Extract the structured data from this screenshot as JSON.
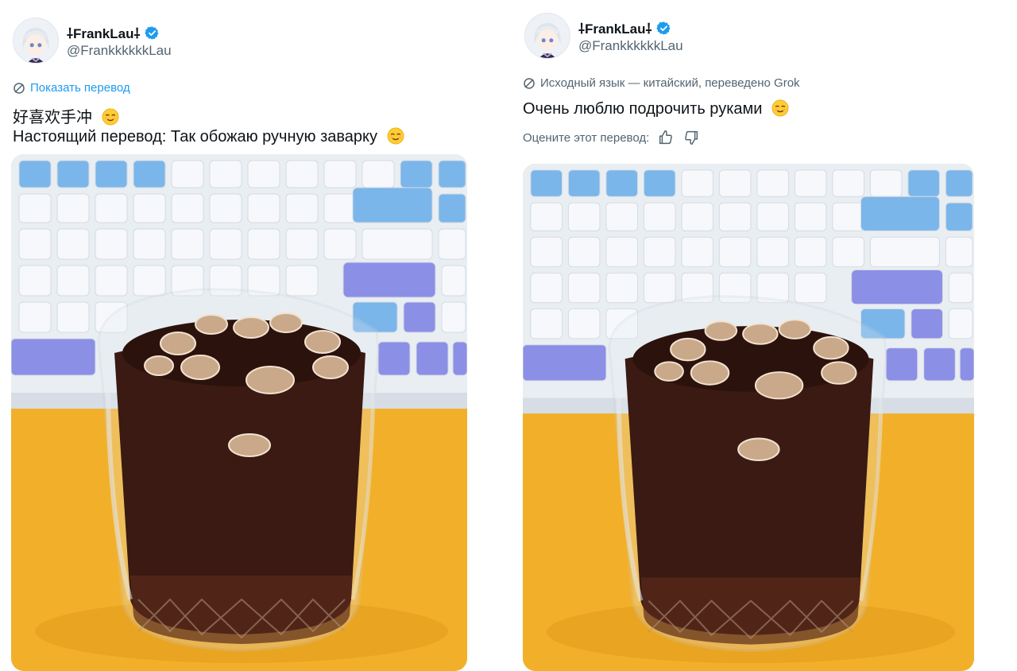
{
  "posts": [
    {
      "author": {
        "display_name": "⸸FrankLau⸸",
        "handle": "@FrankkkkkkLau",
        "verified": true
      },
      "translate_link": "Показать перевод",
      "text_lines": [
        "好喜欢手冲",
        "Настоящий перевод: Так обожаю ручную заварку"
      ],
      "emoji": "relieved-face"
    },
    {
      "author": {
        "display_name": "⸸FrankLau⸸",
        "handle": "@FrankkkkkkLau",
        "verified": true
      },
      "translation_info": "Исходный язык — китайский, переведено Grok",
      "text_lines": [
        "Очень люблю подрочить руками"
      ],
      "emoji": "relieved-face",
      "rate_label": "Оцените этот перевод:"
    }
  ],
  "colors": {
    "accent": "#1d9bf0",
    "muted": "#536471",
    "text": "#0f1419",
    "table": "#f2b02a",
    "drink": "#3a1a12"
  },
  "icons": [
    "verified-badge-icon",
    "translate-globe-icon",
    "relieved-face-emoji",
    "thumbs-up-icon",
    "thumbs-down-icon"
  ]
}
